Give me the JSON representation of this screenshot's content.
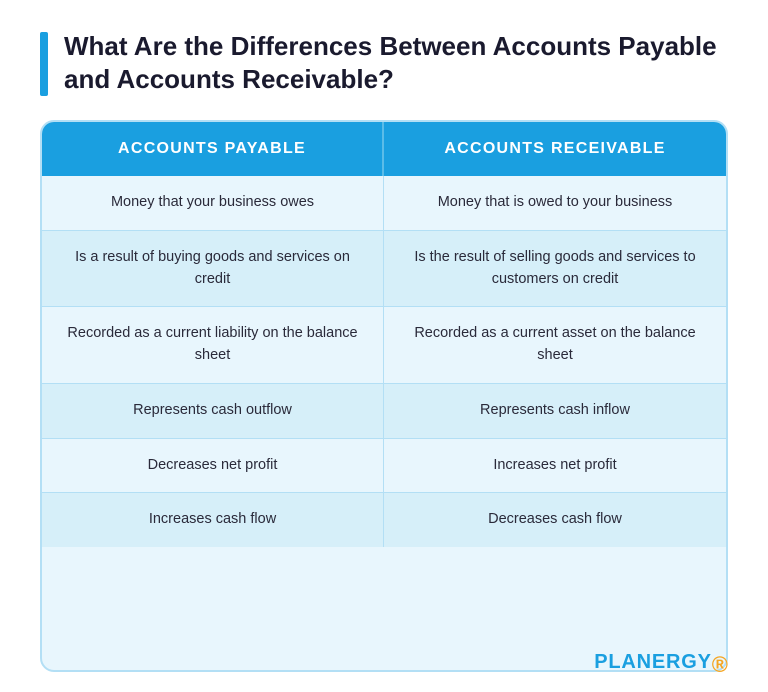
{
  "page": {
    "title": "What Are the Differences Between Accounts Payable and Accounts Receivable?",
    "brand": "PLANERGY",
    "brand_dot": "·"
  },
  "table": {
    "header": {
      "col1": "ACCOUNTS PAYABLE",
      "col2": "ACCOUNTS RECEIVABLE"
    },
    "rows": [
      {
        "col1": "Money that your business owes",
        "col2": "Money that is owed to your business"
      },
      {
        "col1": "Is a result of buying goods and services on credit",
        "col2": "Is the result of selling goods and services to customers on credit"
      },
      {
        "col1": "Recorded as a current liability on the balance sheet",
        "col2": "Recorded as a current asset on the balance sheet"
      },
      {
        "col1": "Represents cash outflow",
        "col2": "Represents cash inflow"
      },
      {
        "col1": "Decreases net profit",
        "col2": "Increases net profit"
      },
      {
        "col1": "Increases cash flow",
        "col2": "Decreases cash flow"
      }
    ]
  }
}
